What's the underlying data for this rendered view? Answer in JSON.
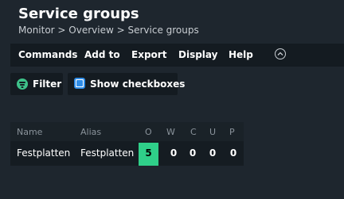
{
  "header": {
    "title": "Service groups",
    "breadcrumb": "Monitor > Overview > Service groups"
  },
  "menu": {
    "items": [
      "Commands",
      "Add to",
      "Export",
      "Display",
      "Help"
    ]
  },
  "toolbar": {
    "filter_label": "Filter",
    "checkboxes_label": "Show checkboxes"
  },
  "table": {
    "headers": [
      "Name",
      "Alias",
      "O",
      "W",
      "C",
      "U",
      "P"
    ],
    "rows": [
      {
        "name": "Festplatten",
        "alias": "Festplatten",
        "ok": "5",
        "warn": "0",
        "crit": "0",
        "unknown": "0",
        "pending": "0"
      }
    ]
  },
  "colors": {
    "background": "#1e262e",
    "ok": "#2fcf89",
    "filter_icon": "#3ec28a",
    "checkbox_icon": "#2f8de8"
  }
}
